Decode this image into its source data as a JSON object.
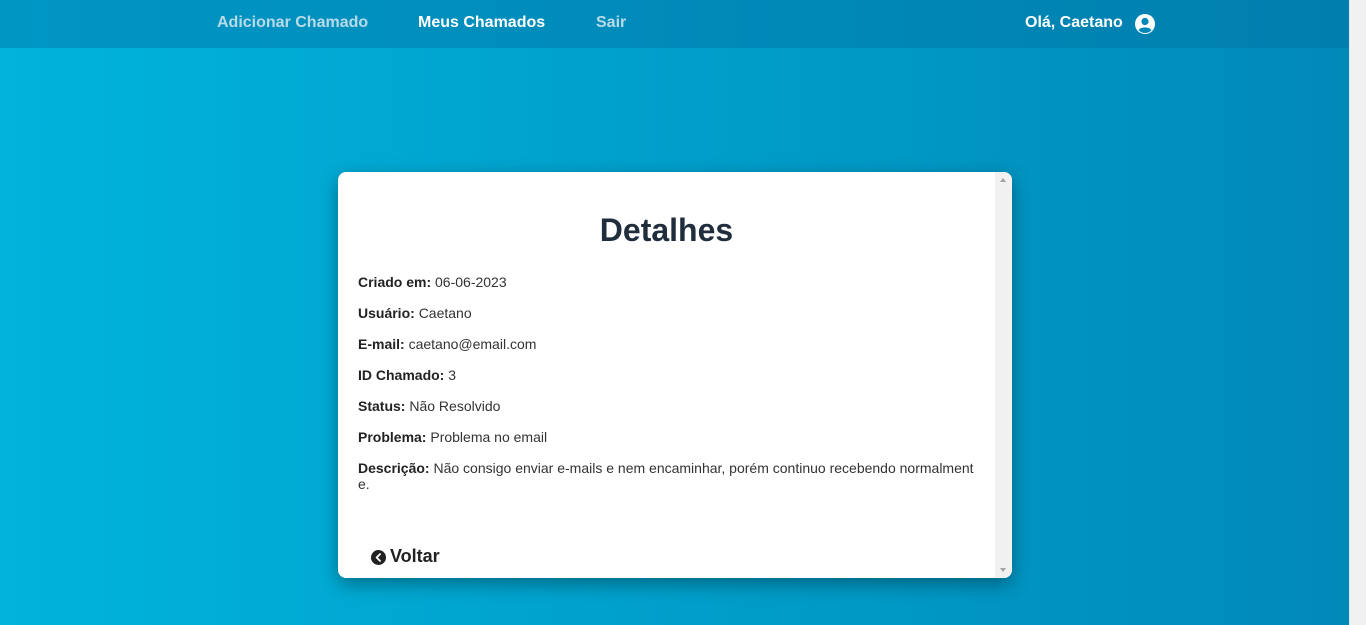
{
  "nav": {
    "add_ticket": "Adicionar Chamado",
    "my_tickets": "Meus Chamados",
    "logout": "Sair",
    "greeting": "Olá, Caetano"
  },
  "card": {
    "title": "Detalhes",
    "fields": [
      {
        "label": "Criado em:",
        "value": "06-06-2023"
      },
      {
        "label": "Usuário:",
        "value": "Caetano"
      },
      {
        "label": "E-mail:",
        "value": "caetano@email.com"
      },
      {
        "label": "ID Chamado:",
        "value": "3"
      },
      {
        "label": "Status:",
        "value": "Não Resolvido"
      },
      {
        "label": "Problema:",
        "value": "Problema no email"
      },
      {
        "label": "Descrição:",
        "value": "Não consigo enviar e-mails e nem encaminhar, porém continuo recebendo normalmente."
      }
    ],
    "back_label": "Voltar"
  },
  "icons": {
    "user": "user-circle-icon",
    "back": "chevron-left-circle-icon"
  },
  "colors": {
    "background_start": "#00b4dc",
    "background_end": "#0089b8",
    "topbar": "#0096c4",
    "title_text": "#1f2d3d"
  }
}
